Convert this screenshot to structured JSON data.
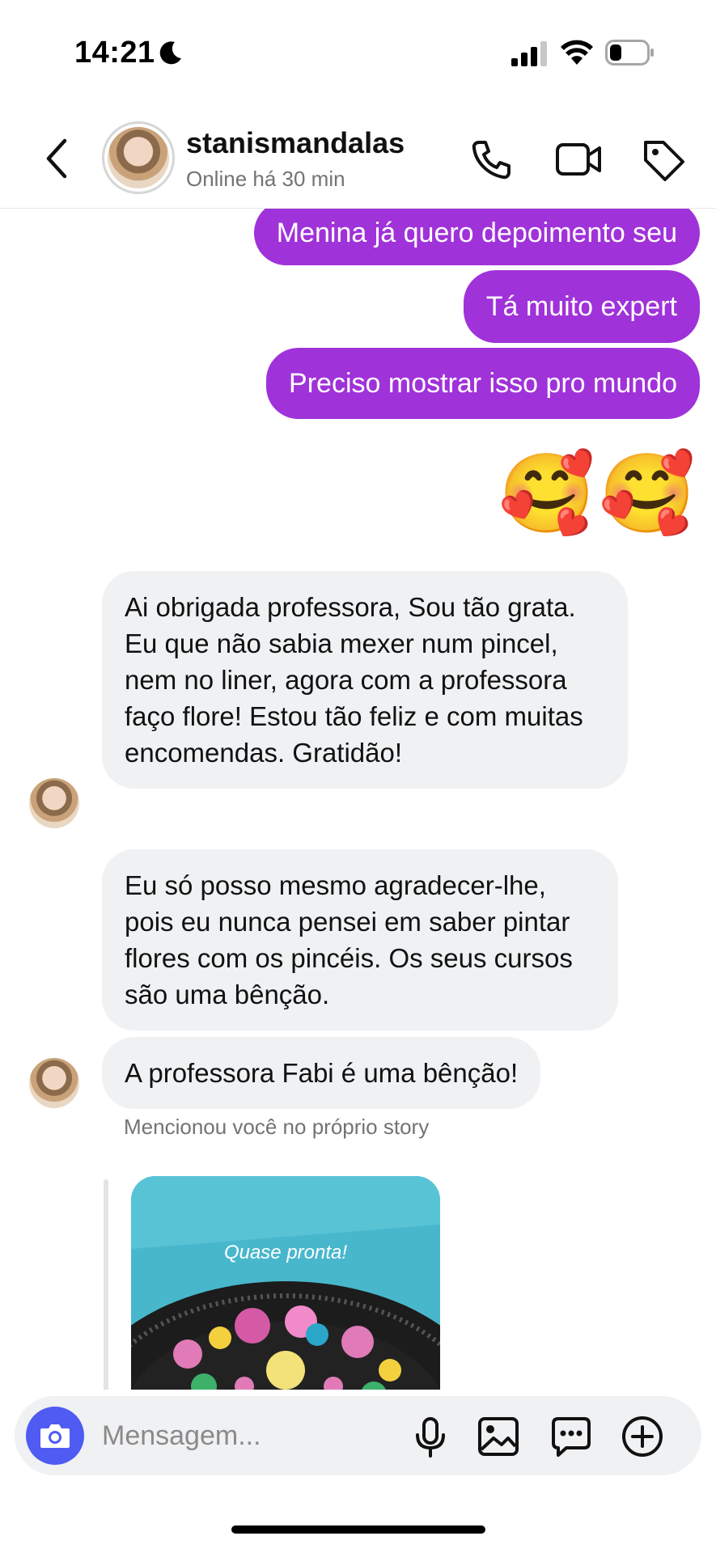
{
  "status_bar": {
    "time": "14:21",
    "battery_percent": 30
  },
  "header": {
    "username": "stanismandalas",
    "presence": "Online há 30 min",
    "icons": [
      "back-chevron-icon",
      "phone-icon",
      "video-camera-icon",
      "tag-icon"
    ]
  },
  "messages": {
    "outgoing": [
      "Menina já quero depoimento seu",
      "Tá muito expert",
      "Preciso mostrar isso pro mundo"
    ],
    "emoji_reactions": [
      "🥰",
      "🥰"
    ],
    "incoming": [
      "Ai obrigada professora,  Sou tão grata.  Eu que não sabia mexer num pincel, nem no liner, agora com a professora faço flore! Estou tão feliz e com muitas encomendas. Gratidão!",
      "Eu só posso mesmo agradecer-lhe, pois eu nunca pensei em saber pintar flores com os pincéis.  Os seus cursos são uma bênção.",
      "A professora Fabi é uma bênção!"
    ],
    "story_caption": "Mencionou você no próprio story",
    "story_overlay_text": "Quase pronta!"
  },
  "composer": {
    "placeholder": "Mensagem...",
    "icons": [
      "camera-icon",
      "microphone-icon",
      "gallery-icon",
      "sticker-icon",
      "add-icon"
    ]
  },
  "colors": {
    "outgoing_bubble": "#a032d9",
    "incoming_bubble": "#eff1f3",
    "camera_button": "#4f5bf2"
  }
}
